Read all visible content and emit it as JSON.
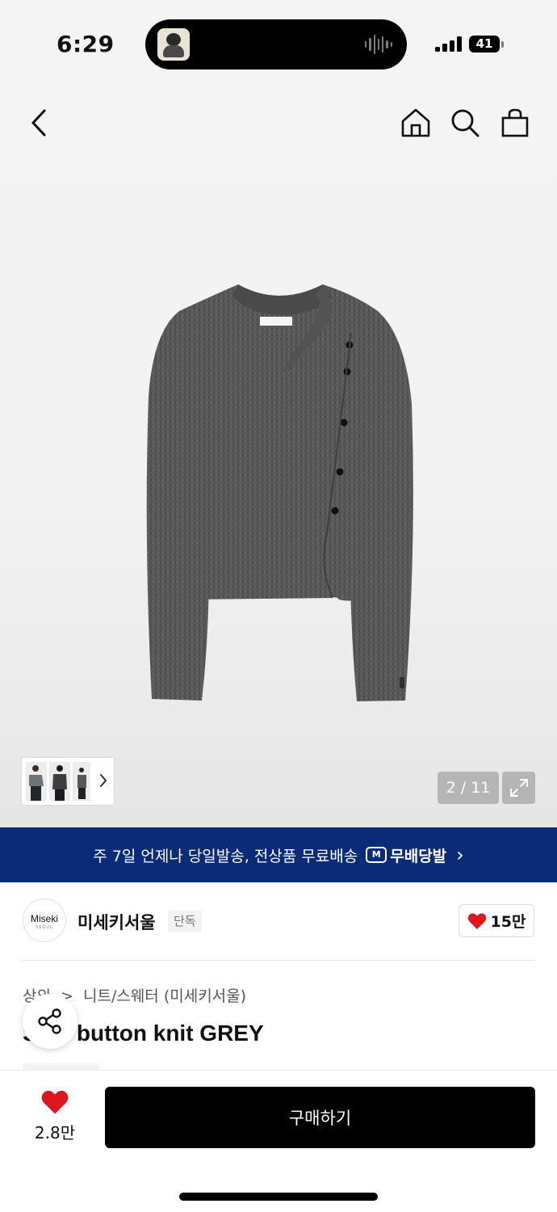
{
  "status_bar": {
    "time": "6:29",
    "battery": "41"
  },
  "nav": {
    "back_icon": "chevron-left-icon",
    "home_icon": "home-icon",
    "search_icon": "search-icon",
    "cart_icon": "shopping-bag-icon"
  },
  "gallery": {
    "counter": "2 / 11",
    "expand_icon": "expand-icon",
    "thumbnails_count": 3
  },
  "promo": {
    "text": "주 7일 언제나 당일발송, 전상품 무료배송",
    "badge_mark": "M",
    "badge_text": "무배당발",
    "chevron": "›"
  },
  "brand": {
    "logo_line1": "Miseki",
    "logo_line2": "SEOUL",
    "name": "미세키서울",
    "tag": "단독",
    "likes": "15만"
  },
  "product": {
    "breadcrumb_category": "상의",
    "breadcrumb_separator": ">",
    "breadcrumb_sub": "니트/스웨터 (미세키서울)",
    "title": "Side button knit GREY"
  },
  "bottom_bar": {
    "wishlist_count": "2.8만",
    "buy_label": "구매하기"
  },
  "colors": {
    "promo_bg": "#0b2a78",
    "heart": "#e0161e",
    "buy_bg": "#000000"
  }
}
